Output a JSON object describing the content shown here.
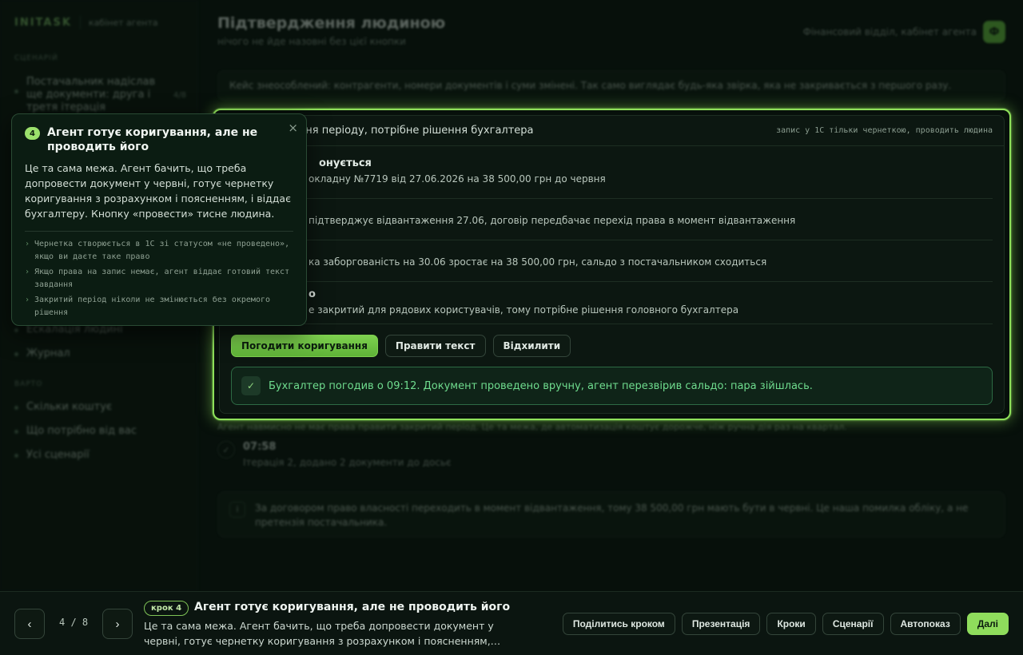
{
  "sidebar": {
    "brand": "INITASK",
    "brand_sub": "кабінет агента",
    "section_scenario": "СЦЕНАРІЙ",
    "scenario_item": "Постачальник надіслав ще документи: друга і третя ітерація",
    "scenario_count": "4/8",
    "items_mid": [
      "Ескалація людині",
      "Журнал"
    ],
    "section_value": "ВАРТО",
    "items_bottom": [
      "Скільки коштує",
      "Що потрібно від вас",
      "Усі сценарії"
    ]
  },
  "header": {
    "title": "Підтвердження людиною",
    "subtitle": "нічого не йде назовні без цієї кнопки",
    "context": "Фінансовий відділ, кабінет агента",
    "avatar_letter": "Ф"
  },
  "case_banner": "Кейс знеособлений: контрагенти, номери документів і суми змінені. Так само виглядає будь-яка звірка, яка не закривається з першого разу.",
  "decision": {
    "title": "а коригування періоду, потрібне рішення бухгалтера",
    "note": "запис у 1С тільки чернеткою, проводить людина",
    "rows": [
      {
        "label": "онується",
        "value": "окладну №7719 від 27.06.2026 на 38 500,00 грн до червня"
      },
      {
        "label": "",
        "value": "підтверджує відвантаження 27.06, договір передбачає перехід права в момент відвантаження"
      },
      {
        "label": "",
        "value": "ка заборгованість на 30.06 зростає на 38 500,00 грн, сальдо з постачальником сходиться"
      },
      {
        "label": "о",
        "value": "е закритий для рядових користувачів, тому потрібне рішення головного бухгалтера"
      }
    ],
    "buttons": {
      "approve": "Погодити коригування",
      "edit": "Правити текст",
      "reject": "Відхилити"
    },
    "confirm_icon": "✓",
    "confirm_text": "Бухгалтер погодив о 09:12. Документ проведено вручну, агент перезвірив сальдо: пара зійшлась."
  },
  "below_caption": "Агент навмисно не має права правити закритий період. Це та межа, де автоматизація коштує дорожче, ніж ручна дія раз на квартал.",
  "log": {
    "check": "✓",
    "time": "07:58",
    "text": "Ітерація 2, додано 2 документи до досьє"
  },
  "note": {
    "icon": "i",
    "text": "За договором право власності переходить в момент відвантаження, тому 38 500,00 грн мають бути в червні. Це наша помилка обліку, а не претензія постачальника."
  },
  "popover": {
    "number": "4",
    "title": "Агент готує коригування, але не проводить його",
    "close": "×",
    "body": "Це та сама межа. Агент бачить, що треба допровести документ у червні, готує чернетку коригування з розрахунком і поясненням, і віддає бухгалтеру. Кнопку «провести» тисне людина.",
    "bullet": "›",
    "points": [
      "Чернетка створюється в 1С зі статусом «не проведено», якщо ви даєте таке право",
      "Якщо права на запис немає, агент віддає готовий текст завдання",
      "Закритий період ніколи не змінюється без окремого рішення"
    ]
  },
  "stepbar": {
    "prev": "‹",
    "next": "›",
    "pager": "4 / 8",
    "pill": "крок 4",
    "title": "Агент готує коригування, але не проводить його",
    "desc": "Це та сама межа. Агент бачить, що треба допровести документ у червні, готує чернетку коригування з розрахунком і поясненням,…",
    "actions": [
      "Поділитись кроком",
      "Презентація",
      "Кроки",
      "Сценарії",
      "Автопоказ"
    ],
    "primary": "Далі"
  },
  "colors": {
    "accent": "#8ee05a",
    "background": "#07100b",
    "confirm_text": "#6fdc8e"
  }
}
